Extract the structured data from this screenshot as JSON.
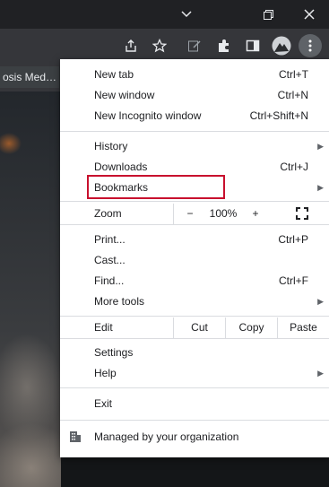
{
  "browser": {
    "tab_title": "osis Med…",
    "toolbar_icons": [
      "share-icon",
      "star-icon",
      "edit-icon",
      "extensions-icon",
      "sidepanel-icon",
      "avatar",
      "kebab-menu-icon"
    ],
    "window_controls": [
      "chevron-down-icon",
      "restore-icon",
      "close-icon"
    ]
  },
  "menu": {
    "new_tab": {
      "label": "New tab",
      "shortcut": "Ctrl+T"
    },
    "new_window": {
      "label": "New window",
      "shortcut": "Ctrl+N"
    },
    "new_incognito": {
      "label": "New Incognito window",
      "shortcut": "Ctrl+Shift+N"
    },
    "history": {
      "label": "History"
    },
    "downloads": {
      "label": "Downloads",
      "shortcut": "Ctrl+J"
    },
    "bookmarks": {
      "label": "Bookmarks"
    },
    "zoom": {
      "label": "Zoom",
      "minus": "−",
      "value": "100%",
      "plus": "+"
    },
    "print": {
      "label": "Print...",
      "shortcut": "Ctrl+P"
    },
    "cast": {
      "label": "Cast..."
    },
    "find": {
      "label": "Find...",
      "shortcut": "Ctrl+F"
    },
    "more_tools": {
      "label": "More tools"
    },
    "edit": {
      "label": "Edit",
      "cut": "Cut",
      "copy": "Copy",
      "paste": "Paste"
    },
    "settings": {
      "label": "Settings"
    },
    "help": {
      "label": "Help"
    },
    "exit": {
      "label": "Exit"
    },
    "managed": {
      "label": "Managed by your organization"
    }
  },
  "colors": {
    "highlight_border": "#c8102e",
    "toolbar": "#35363a",
    "titlebar": "#202124"
  }
}
